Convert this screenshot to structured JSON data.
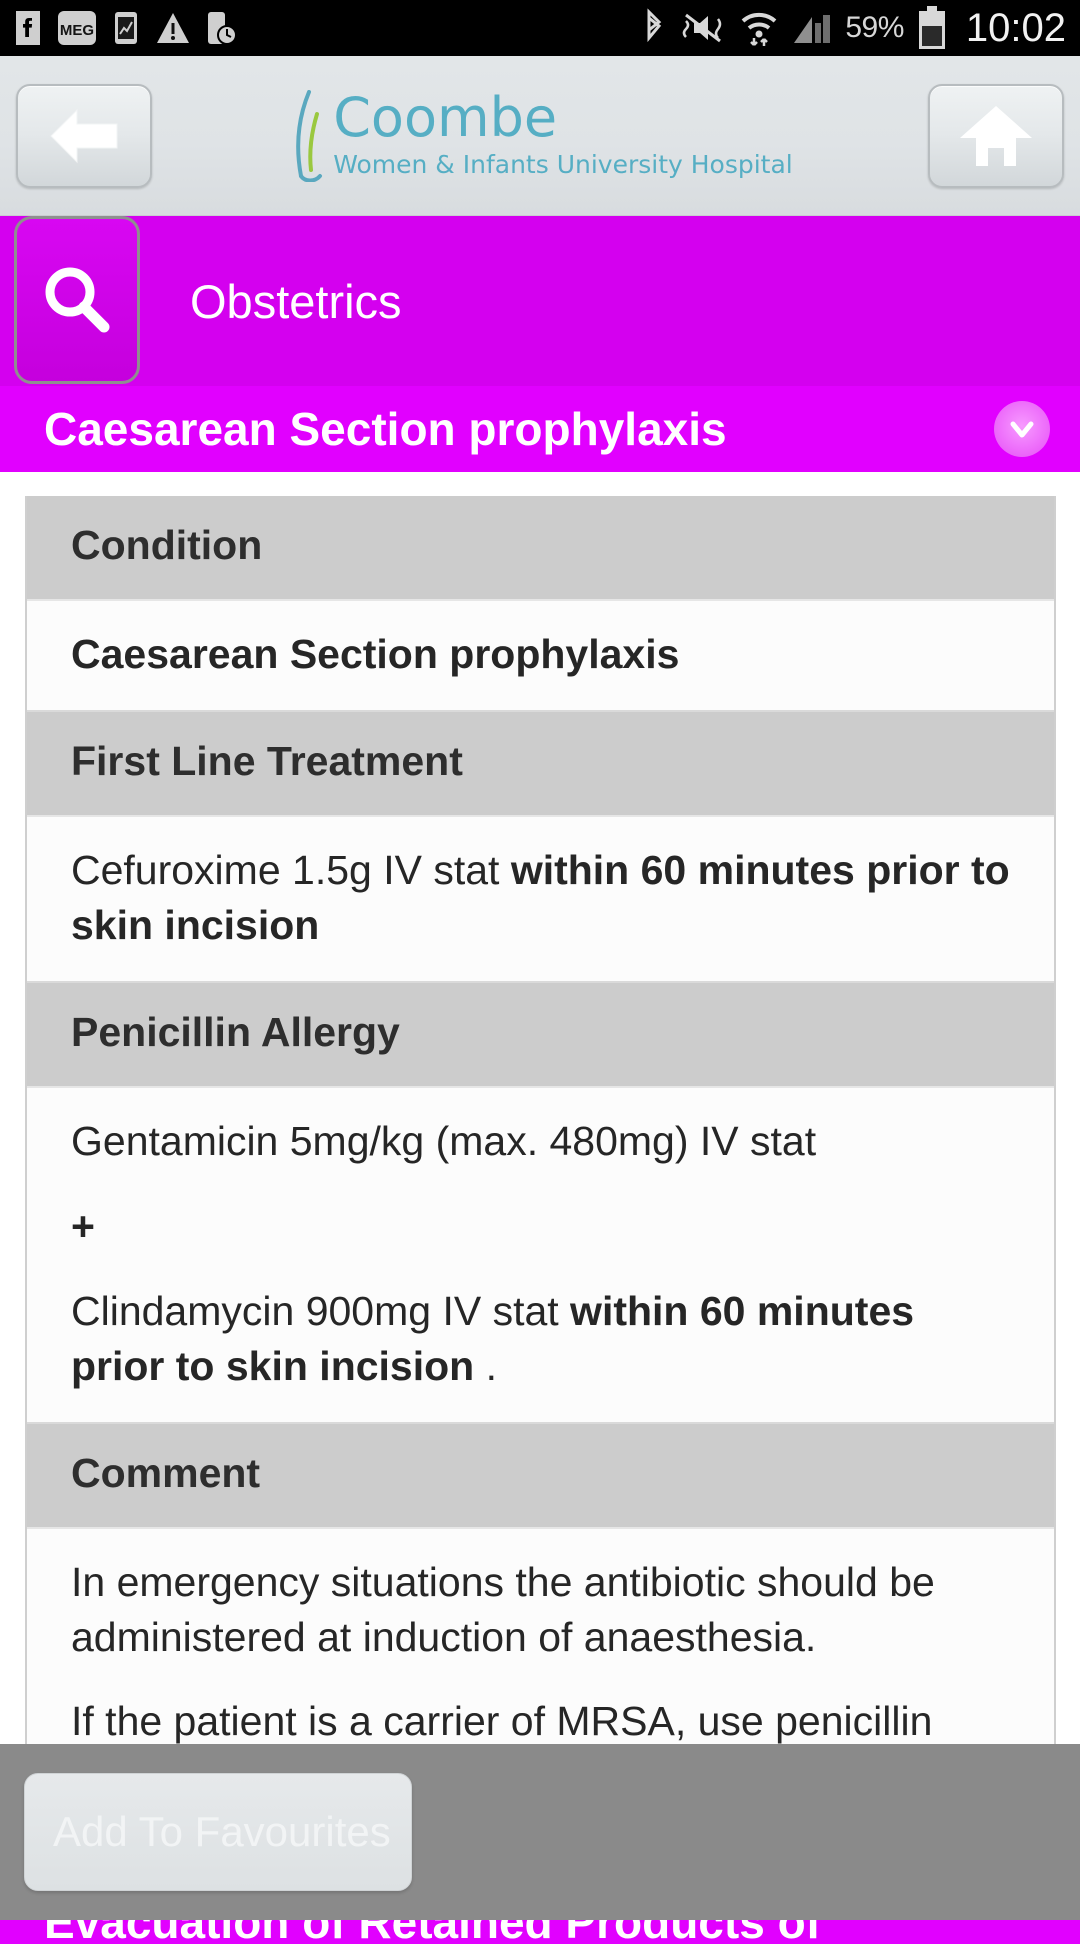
{
  "statusbar": {
    "icons_left": [
      "facebook-icon",
      "meg-icon",
      "screenshot-icon",
      "warning-icon",
      "phone-clock-icon"
    ],
    "icons_right": [
      "bluetooth-icon",
      "mute-vibrate-icon",
      "wifi-icon",
      "signal-icon"
    ],
    "meg_label": "MEG",
    "battery_percent": "59%",
    "clock": "10:02"
  },
  "appbar": {
    "back_icon": "back-arrow-icon",
    "home_icon": "home-icon",
    "logo_title": "Coombe",
    "logo_subtitle": "Women & Infants University Hospital",
    "logo_color": "#56aec4"
  },
  "searchbar": {
    "search_icon": "search-icon",
    "title": "Obstetrics",
    "background": "#d400ef"
  },
  "section": {
    "title": "Caesarean Section prophylaxis",
    "expand_icon": "chevron-down-icon",
    "background": "#e100ff"
  },
  "table": {
    "rows": [
      {
        "type": "header",
        "label": "Condition"
      },
      {
        "type": "body",
        "text": "Caesarean Section prophylaxis",
        "bold": true
      },
      {
        "type": "header",
        "label": "First Line Treatment"
      },
      {
        "type": "body",
        "paragraphs": [
          {
            "parts": [
              {
                "text": "Cefuroxime 1.5g IV stat ",
                "bold": false
              },
              {
                "text": "within 60 minutes prior to skin incision",
                "bold": true
              }
            ]
          }
        ]
      },
      {
        "type": "header",
        "label": "Penicillin Allergy"
      },
      {
        "type": "body",
        "paragraphs": [
          {
            "parts": [
              {
                "text": "Gentamicin 5mg/kg (max. 480mg) IV stat",
                "bold": false
              }
            ]
          },
          {
            "parts": [
              {
                "text": "+",
                "bold": true
              }
            ]
          },
          {
            "parts": [
              {
                "text": "Clindamycin 900mg IV stat ",
                "bold": false
              },
              {
                "text": "within 60 minutes prior to skin incision",
                "bold": true
              },
              {
                "text": " .",
                "bold": false
              }
            ]
          }
        ]
      },
      {
        "type": "header",
        "label": "Comment"
      },
      {
        "type": "body",
        "paragraphs": [
          {
            "parts": [
              {
                "text": "In emergency situations the antibiotic should be administered at induction of anaesthesia.",
                "bold": false
              }
            ]
          },
          {
            "parts": [
              {
                "text": "If the patient is a carrier of MRSA, use penicillin allergic regimen considering sensitivity profile.",
                "bold": false
              }
            ]
          }
        ]
      }
    ]
  },
  "next_section": {
    "title": "Evacuation of Retained Products of"
  },
  "bottombar": {
    "favourites_label": "Add To Favourites",
    "background": "#8a8a8a"
  }
}
